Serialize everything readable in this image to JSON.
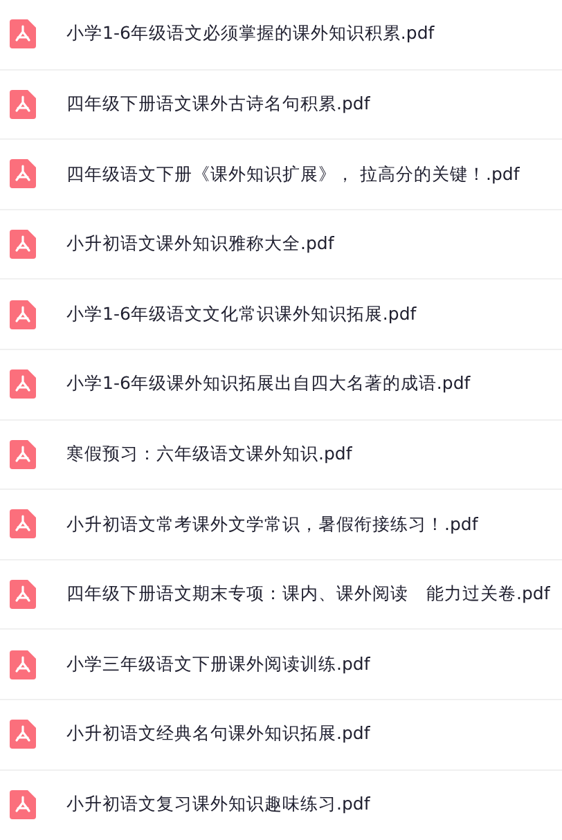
{
  "files": [
    {
      "name": "小学1-6年级语文必须掌握的课外知识积累.pdf"
    },
    {
      "name": "四年级下册语文课外古诗名句积累.pdf"
    },
    {
      "name": "四年级语文下册《课外知识扩展》， 拉高分的关键！.pdf"
    },
    {
      "name": "小升初语文课外知识雅称大全.pdf"
    },
    {
      "name": "小学1-6年级语文文化常识课外知识拓展.pdf"
    },
    {
      "name": "小学1-6年级课外知识拓展出自四大名著的成语.pdf"
    },
    {
      "name": "寒假预习：六年级语文课外知识.pdf"
    },
    {
      "name": "小升初语文常考课外文学常识，暑假衔接练习！.pdf"
    },
    {
      "name": "四年级下册语文期末专项：课内、课外阅读　能力过关卷.pdf"
    },
    {
      "name": "小学三年级语文下册课外阅读训练.pdf"
    },
    {
      "name": "小升初语文经典名句课外知识拓展.pdf"
    },
    {
      "name": "小升初语文复习课外知识趣味练习.pdf"
    }
  ]
}
